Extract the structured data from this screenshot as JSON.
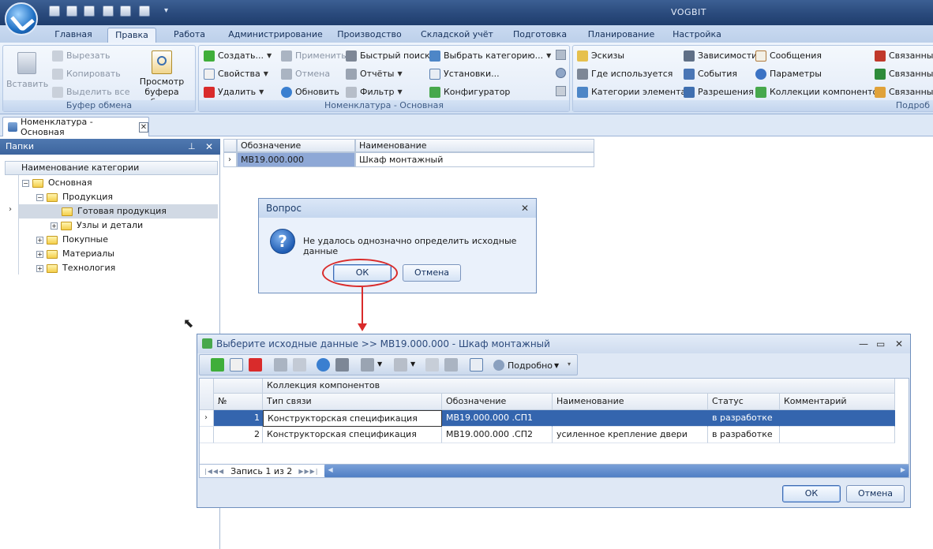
{
  "app": {
    "title": "VOGBIT"
  },
  "ribbon_tabs": [
    "Главная",
    "Правка",
    "Работа",
    "Администрирование",
    "Производство",
    "Складской учёт",
    "Подготовка",
    "Планирование",
    "Настройка"
  ],
  "active_tab": "Правка",
  "clipboard_group": {
    "caption": "Буфер обмена",
    "paste": "Вставить",
    "cut": "Вырезать",
    "copy": "Копировать",
    "select_all": "Выделить все",
    "preview": "Просмотр",
    "preview2": "буфера обмена"
  },
  "nomenclature_group": {
    "caption": "Номенклатура - Основная",
    "create": "Создать...",
    "properties": "Свойства",
    "delete": "Удалить",
    "apply": "Применить",
    "cancel": "Отмена",
    "refresh": "Обновить",
    "quick_search": "Быстрый поиск",
    "reports": "Отчёты",
    "filter": "Фильтр",
    "select_categories": "Выбрать категорию...",
    "settings": "Установки...",
    "configurator": "Конфигуратор"
  },
  "links_group": {
    "caption": "Подробно",
    "sketches": "Эскизы",
    "where_used": "Где используется",
    "element_categories": "Категории элемента",
    "dependencies": "Зависимости",
    "events": "События",
    "permissions": "Разрешения",
    "messages": "Сообщения",
    "parameters": "Параметры",
    "component_collections": "Коллекции компонентов",
    "related1": "Связанные",
    "related2": "Связанные",
    "related3": "Связанные",
    "caption_partial": "Подроб"
  },
  "doc_tab": {
    "label": "Номенклатура - Основная"
  },
  "folders": {
    "title": "Папки",
    "header": "Наименование категории",
    "items": [
      {
        "label": "Основная"
      },
      {
        "label": "Продукция"
      },
      {
        "label": "Готовая продукция"
      },
      {
        "label": "Узлы и детали"
      },
      {
        "label": "Покупные"
      },
      {
        "label": "Материалы"
      },
      {
        "label": "Технология"
      }
    ]
  },
  "main_grid": {
    "col1": "Обозначение",
    "col2": "Наименование",
    "row": {
      "designation": "МВ19.000.000",
      "name": "Шкаф монтажный"
    }
  },
  "question_dialog": {
    "title": "Вопрос",
    "message": "Не удалось однозначно определить исходные данные",
    "ok": "ОК",
    "cancel": "Отмена"
  },
  "select_dialog": {
    "title": "Выберите исходные данные >> МВ19.000.000 - Шкаф монтажный",
    "toolbar_detail": "Подробно",
    "group_header": "Коллекция компонентов",
    "columns": [
      "№",
      "Тип связи",
      "Обозначение",
      "Наименование",
      "Статус",
      "Комментарий"
    ],
    "rows": [
      {
        "num": "1",
        "type": "Конструкторская спецификация",
        "designation": "МВ19.000.000 .СП1",
        "name": "",
        "status": "в разработке",
        "comment": ""
      },
      {
        "num": "2",
        "type": "Конструкторская спецификация",
        "designation": "МВ19.000.000 .СП2",
        "name": "усиленное крепление двери",
        "status": "в разработке",
        "comment": ""
      }
    ],
    "nav_record": "Запись 1 из 2",
    "ok": "ОК",
    "cancel": "Отмена"
  },
  "colors": {
    "selection": "#3465ae",
    "highlight": "#d92b2b",
    "titlebar": "#2a4a7c"
  }
}
